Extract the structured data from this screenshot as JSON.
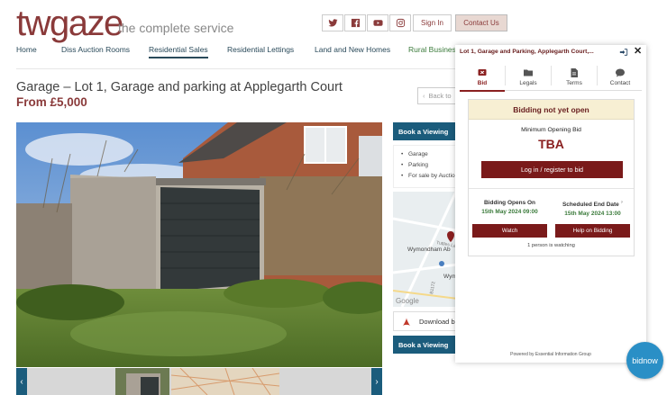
{
  "header": {
    "logo": "twgaze",
    "tagline": "the complete service",
    "social_icons": [
      "twitter-icon",
      "facebook-icon",
      "youtube-icon",
      "instagram-icon"
    ],
    "sign_in": "Sign In",
    "contact": "Contact Us"
  },
  "nav": {
    "items": [
      "Home",
      "Diss Auction Rooms",
      "Residential Sales",
      "Residential Lettings",
      "Land and New Homes",
      "Rural Business"
    ],
    "active": "Residential Sales"
  },
  "listing": {
    "title": "Garage – Lot 1, Garage and parking at Applegarth Court",
    "price": "From £5,000",
    "back": "Back to"
  },
  "sidebar": {
    "book_viewing": "Book a Viewing",
    "features": [
      "Garage",
      "Parking",
      "For sale by Auction"
    ],
    "map_label": "Wymondham Ab",
    "map_label2": "Wym",
    "map_road": "Tuttles La W",
    "map_road2": "B1172",
    "map_google": "Google",
    "download": "Download b",
    "book_viewing_2": "Book a Viewing"
  },
  "widget": {
    "heading": "Lot 1, Garage and Parking, Applegarth Court,...",
    "tabs": [
      {
        "label": "Bid",
        "icon": "gavel-icon"
      },
      {
        "label": "Legals",
        "icon": "folder-icon"
      },
      {
        "label": "Terms",
        "icon": "document-icon"
      },
      {
        "label": "Contact",
        "icon": "chat-icon"
      }
    ],
    "status": "Bidding not yet open",
    "min_bid_label": "Minimum Opening Bid",
    "min_bid_value": "TBA",
    "login_button": "Log in / register to bid",
    "opens_label": "Bidding Opens On",
    "opens_value": "15th May 2024 09:00",
    "end_label": "Scheduled End Date",
    "end_q": "?",
    "end_value": "15th May 2024 13:00",
    "watch": "Watch",
    "help": "Help on Bidding",
    "watching": "1 person is watching",
    "powered": "Powered by Essential Information Group"
  },
  "bidnow": "bidnow",
  "colors": {
    "brand": "#8a3a3a",
    "primary_blue": "#1b5c7c",
    "bid_red": "#7a1a1a",
    "status_bg": "#f7efd3",
    "date_green": "#3a7a3a",
    "bidnow_blue": "#2a8fc6"
  }
}
